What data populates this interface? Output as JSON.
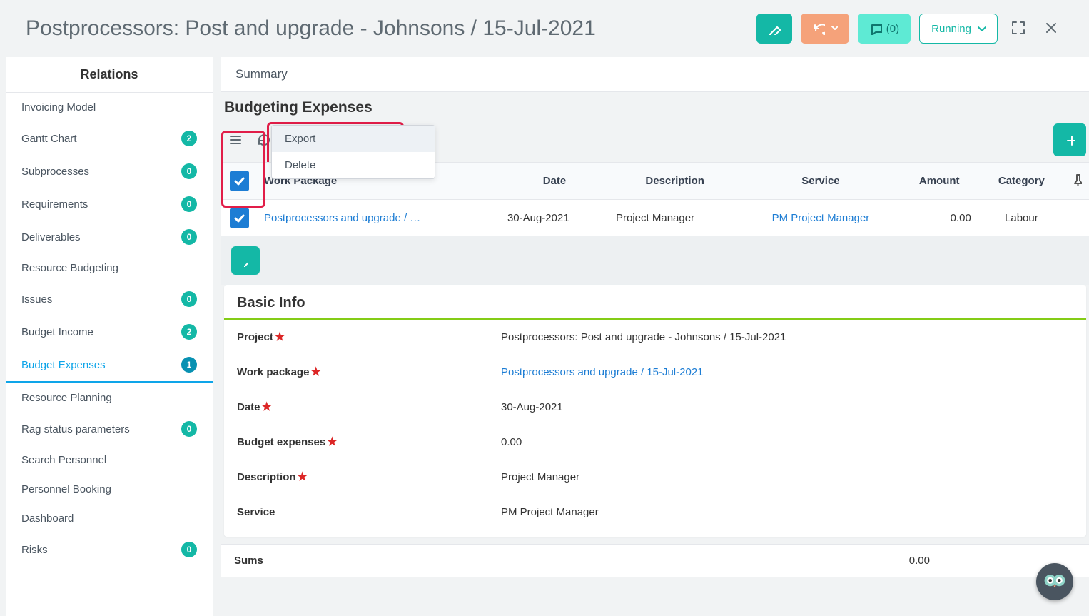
{
  "header": {
    "title": "Postprocessors: Post and upgrade - Johnsons / 15-Jul-2021",
    "comments_label": "(0)",
    "status_label": "Running"
  },
  "sidebar": {
    "title": "Relations",
    "items": [
      {
        "label": "Invoicing Model",
        "badge": null
      },
      {
        "label": "Gantt Chart",
        "badge": "2"
      },
      {
        "label": "Subprocesses",
        "badge": "0"
      },
      {
        "label": "Requirements",
        "badge": "0"
      },
      {
        "label": "Deliverables",
        "badge": "0"
      },
      {
        "label": "Resource Budgeting",
        "badge": null
      },
      {
        "label": "Issues",
        "badge": "0"
      },
      {
        "label": "Budget Income",
        "badge": "2"
      },
      {
        "label": "Budget Expenses",
        "badge": "1",
        "active": true
      },
      {
        "label": "Resource Planning",
        "badge": null
      },
      {
        "label": "Rag status parameters",
        "badge": "0"
      },
      {
        "label": "Search Personnel",
        "badge": null
      },
      {
        "label": "Personnel Booking",
        "badge": null
      },
      {
        "label": "Dashboard",
        "badge": null
      },
      {
        "label": "Risks",
        "badge": "0"
      }
    ]
  },
  "main": {
    "tab": "Summary",
    "section": "Budgeting Expenses",
    "context_menu": {
      "export": "Export",
      "delete": "Delete"
    },
    "columns": {
      "wp": "Work Package",
      "date": "Date",
      "desc": "Description",
      "service": "Service",
      "amount": "Amount",
      "category": "Category"
    },
    "rows": [
      {
        "wp": "Postprocessors and upgrade / …",
        "date": "30-Aug-2021",
        "desc": "Project Manager",
        "service": "PM Project Manager",
        "amount": "0.00",
        "category": "Labour"
      }
    ],
    "sums": {
      "label": "Sums",
      "amount": "0.00"
    }
  },
  "detail": {
    "title": "Basic Info",
    "fields": [
      {
        "label": "Project",
        "required": true,
        "value": "Postprocessors: Post and upgrade - Johnsons / 15-Jul-2021",
        "link": false
      },
      {
        "label": "Work package",
        "required": true,
        "value": "Postprocessors and upgrade / 15-Jul-2021",
        "link": true
      },
      {
        "label": "Date",
        "required": true,
        "value": "30-Aug-2021",
        "link": false
      },
      {
        "label": "Budget expenses",
        "required": true,
        "value": "0.00",
        "link": false
      },
      {
        "label": "Description",
        "required": true,
        "value": "Project Manager",
        "link": false
      },
      {
        "label": "Service",
        "required": false,
        "value": "PM Project Manager",
        "link": false
      }
    ]
  }
}
